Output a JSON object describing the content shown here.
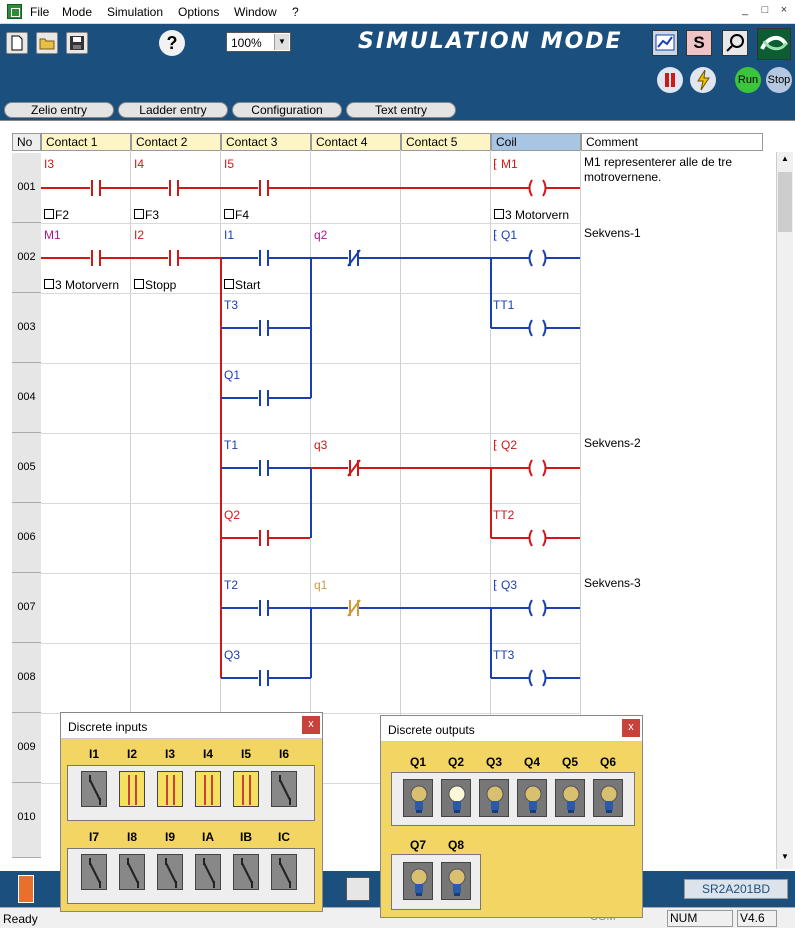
{
  "menu": [
    "File",
    "Mode",
    "Simulation",
    "Options",
    "Window",
    "?"
  ],
  "window_buttons": [
    "_",
    "□",
    "×"
  ],
  "toolbar": {
    "zoom": "100%",
    "title": "SIMULATION MODE",
    "s_label": "S",
    "run": "Run",
    "stop": "Stop"
  },
  "tabs": [
    "Zelio entry",
    "Ladder entry",
    "Configuration",
    "Text entry"
  ],
  "columns": [
    "No",
    "Contact 1",
    "Contact 2",
    "Contact 3",
    "Contact 4",
    "Contact 5",
    "Coil",
    "Comment"
  ],
  "rows": [
    "001",
    "002",
    "003",
    "004",
    "005",
    "006",
    "007",
    "008",
    "009",
    "010"
  ],
  "ladder": {
    "r1": {
      "c1": "I3",
      "c2": "I4",
      "c3": "I5",
      "coil": "M1",
      "n1": "F2",
      "n2": "F3",
      "n3": "F4",
      "ncoil": "3 Motorvern",
      "comment": "M1 representerer alle de tre motrovernene."
    },
    "r2": {
      "c1": "M1",
      "c2": "I2",
      "c3": "I1",
      "c4": "q2",
      "coil": "Q1",
      "n1": "3 Motorvern",
      "n2": "Stopp",
      "n3": "Start",
      "comment": "Sekvens-1"
    },
    "r3": {
      "c3": "T3",
      "coil": "TT1"
    },
    "r4": {
      "c3": "Q1"
    },
    "r5": {
      "c3": "T1",
      "c4": "q3",
      "coil": "Q2",
      "comment": "Sekvens-2"
    },
    "r6": {
      "c3": "Q2",
      "coil": "TT2"
    },
    "r7": {
      "c3": "T2",
      "c4": "q1",
      "coil": "Q3",
      "comment": "Sekvens-3"
    },
    "r8": {
      "c3": "Q3",
      "coil": "TT3"
    }
  },
  "inputs_panel": {
    "title": "Discrete inputs",
    "close": "x",
    "row1": [
      "I1",
      "I2",
      "I3",
      "I4",
      "I5",
      "I6"
    ],
    "row2": [
      "I7",
      "I8",
      "I9",
      "IA",
      "IB",
      "IC"
    ],
    "row1_on": [
      false,
      true,
      true,
      true,
      true,
      false
    ]
  },
  "outputs_panel": {
    "title": "Discrete outputs",
    "close": "x",
    "row1": [
      "Q1",
      "Q2",
      "Q3",
      "Q4",
      "Q5",
      "Q6"
    ],
    "row2": [
      "Q7",
      "Q8"
    ],
    "row1_on": [
      false,
      true,
      false,
      false,
      false,
      false
    ]
  },
  "bottom": {
    "model": "SR2A201BD"
  },
  "status": {
    "ready": "Ready",
    "com": "COM",
    "num": "NUM",
    "version": "V4.6"
  },
  "colors": {
    "toolbar": "#1b4f7e",
    "red": "#d01818",
    "blue": "#1a3fb0",
    "panel": "#f3d564"
  }
}
